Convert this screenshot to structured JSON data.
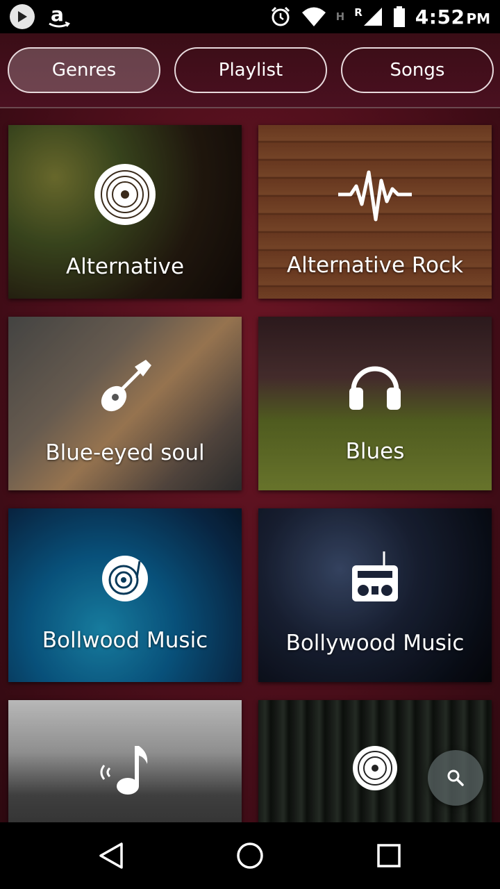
{
  "status_bar": {
    "time": "4:52",
    "ampm": "PM",
    "network_type": "H",
    "roaming": "R",
    "icons": [
      "play-icon",
      "amazon-icon",
      "alarm-icon",
      "wifi-icon",
      "signal-icon",
      "battery-icon"
    ]
  },
  "tabs": [
    {
      "label": "Genres",
      "active": true
    },
    {
      "label": "Playlist",
      "active": false
    },
    {
      "label": "Songs",
      "active": false
    }
  ],
  "genres": [
    {
      "label": "Alternative",
      "icon": "vinyl-record-icon"
    },
    {
      "label": "Alternative Rock",
      "icon": "sound-wave-icon"
    },
    {
      "label": "Blue-eyed soul",
      "icon": "guitar-icon"
    },
    {
      "label": "Blues",
      "icon": "headphones-icon"
    },
    {
      "label": "Bollwood Music",
      "icon": "turntable-icon"
    },
    {
      "label": "Bollywood Music",
      "icon": "boombox-icon"
    },
    {
      "label": "",
      "icon": "music-note-icon"
    },
    {
      "label": "",
      "icon": "vinyl-record-icon"
    }
  ],
  "fab": {
    "icon": "search-icon"
  },
  "nav": {
    "icons": [
      "back-icon",
      "home-icon",
      "recents-icon"
    ]
  },
  "colors": {
    "accent": "#6a1524",
    "tab_border": "#e7d9dc"
  }
}
